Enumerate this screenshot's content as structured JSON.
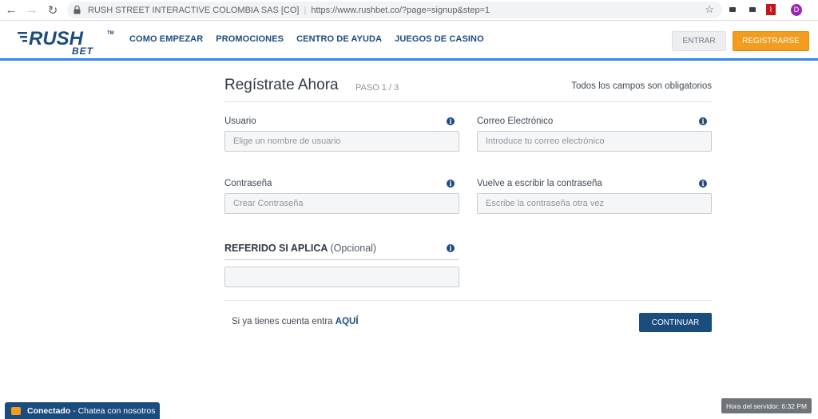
{
  "browser": {
    "site_identity": "RUSH STREET INTERACTIVE COLOMBIA SAS [CO]",
    "url": "https://www.rushbet.co/?page=signup&step=1",
    "profile_initial": "D"
  },
  "header": {
    "logo": {
      "line1": "RUSH",
      "line2": "BET",
      "tm": "TM"
    },
    "nav": [
      "COMO EMPEZAR",
      "PROMOCIONES",
      "CENTRO DE AYUDA",
      "JUEGOS DE CASINO"
    ],
    "entrar_label": "ENTRAR",
    "registrarse_label": "REGISTRARSE",
    "accent_color": "#2f8be6",
    "brand_blue": "#1b4c7e",
    "brand_orange": "#f39c1d"
  },
  "form": {
    "title": "Regístrate Ahora",
    "step": "PASO 1 / 3",
    "required_note": "Todos los campos son obligatorios",
    "fields": {
      "usuario": {
        "label": "Usuario",
        "placeholder": "Elige un nombre de usuario"
      },
      "correo": {
        "label": "Correo Electrónico",
        "placeholder": "Introduce tu correo electrónico"
      },
      "pass": {
        "label": "Contraseña",
        "placeholder": "Crear Contraseña"
      },
      "pass2": {
        "label": "Vuelve a escribir la contraseña",
        "placeholder": "Escribe la contraseña otra vez"
      }
    },
    "referido": {
      "label": "REFERIDO SI APLICA",
      "optional": "(Opcional)"
    },
    "login_text": "Si ya tienes cuenta entra",
    "login_link": "AQUÍ",
    "continue_label": "CONTINUAR"
  },
  "footer": {
    "chat_status": "Conectado",
    "chat_text": "- Chatea con nosotros",
    "server_time": "Hora del servidor: 6:32 PM"
  }
}
